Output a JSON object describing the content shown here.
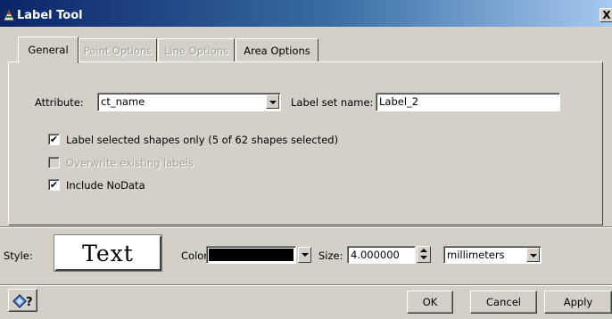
{
  "window": {
    "title": "Label Tool",
    "close_glyph": "X"
  },
  "tabs": [
    {
      "label": "General",
      "state": "active"
    },
    {
      "label": "Point Options",
      "state": "disabled"
    },
    {
      "label": "Line Options",
      "state": "disabled"
    },
    {
      "label": "Area Options",
      "state": "enabled"
    }
  ],
  "general": {
    "attribute_label": "Attribute:",
    "attribute_value": "ct_name",
    "label_set_label": "Label set name:",
    "label_set_value": "Label_2",
    "checkboxes": [
      {
        "label": "Label selected shapes only (5 of 62 shapes selected)",
        "checked": true,
        "enabled": true
      },
      {
        "label": "Overwrite existing labels",
        "checked": false,
        "enabled": false
      },
      {
        "label": "Include NoData",
        "checked": true,
        "enabled": true
      }
    ]
  },
  "style_row": {
    "style_label": "Style:",
    "preview_text": "Text",
    "color_label": "Color:",
    "color_value": "#000000",
    "size_label": "Size:",
    "size_value": "4.000000",
    "unit_value": "millimeters"
  },
  "footer": {
    "help_icon": "help-icon",
    "ok_label": "OK",
    "cancel_label": "Cancel",
    "apply_label": "Apply"
  }
}
